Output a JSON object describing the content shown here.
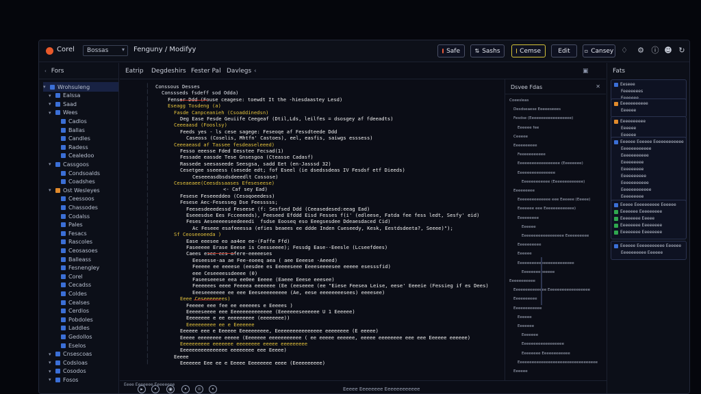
{
  "titlebar": {
    "app_name": "Corel",
    "select_value": "Bossas",
    "breadcrumb": "Fenguny / Modifyy",
    "buttons": [
      {
        "label": "Safe",
        "color": "#e85c3a"
      },
      {
        "label": "Sashs",
        "color": "#d0d4de"
      },
      {
        "label": "Cemse",
        "color": "#e5c33c"
      },
      {
        "label": "Edit",
        "color": "#c8ccd6"
      },
      {
        "label": "Cansey",
        "color": "#c8ccd6"
      }
    ]
  },
  "sidebar": {
    "header": "Fors",
    "items": [
      {
        "label": "Wrohsuleng",
        "level": 0,
        "color": "#3b6fd6"
      },
      {
        "label": "Ealssa",
        "level": 1,
        "color": "#3b6fd6"
      },
      {
        "label": "Saad",
        "level": 1,
        "color": "#3b6fd6"
      },
      {
        "label": "Wees",
        "level": 1,
        "color": "#3b6fd6"
      },
      {
        "label": "Cadlos",
        "level": 2,
        "color": "#3b6fd6"
      },
      {
        "label": "Ballas",
        "level": 2,
        "color": "#3b6fd6"
      },
      {
        "label": "Candles",
        "level": 2,
        "color": "#3b6fd6"
      },
      {
        "label": "Radess",
        "level": 2,
        "color": "#3b6fd6"
      },
      {
        "label": "Cealedoo",
        "level": 2,
        "color": "#3b6fd6"
      },
      {
        "label": "Cassgoos",
        "level": 1,
        "color": "#3b6fd6"
      },
      {
        "label": "Condsoalds",
        "level": 2,
        "color": "#3b6fd6"
      },
      {
        "label": "Coadshes",
        "level": 2,
        "color": "#3b6fd6"
      },
      {
        "label": "Ost Wesleyes",
        "level": 1,
        "color": "#e08a2c"
      },
      {
        "label": "Ceessoos",
        "level": 2,
        "color": "#3b6fd6"
      },
      {
        "label": "Chassodes",
        "level": 2,
        "color": "#3b6fd6"
      },
      {
        "label": "Codalss",
        "level": 2,
        "color": "#3b6fd6"
      },
      {
        "label": "Pales",
        "level": 2,
        "color": "#3b6fd6"
      },
      {
        "label": "Fesacs",
        "level": 2,
        "color": "#3b6fd6"
      },
      {
        "label": "Rascoles",
        "level": 2,
        "color": "#3b6fd6"
      },
      {
        "label": "Ceosasoes",
        "level": 2,
        "color": "#3b6fd6"
      },
      {
        "label": "Balleass",
        "level": 2,
        "color": "#3b6fd6"
      },
      {
        "label": "Fesnengley",
        "level": 2,
        "color": "#3b6fd6"
      },
      {
        "label": "Corel",
        "level": 2,
        "color": "#3b6fd6"
      },
      {
        "label": "Cecadss",
        "level": 2,
        "color": "#3b6fd6"
      },
      {
        "label": "Coldes",
        "level": 2,
        "color": "#3b6fd6"
      },
      {
        "label": "Cealses",
        "level": 2,
        "color": "#3b6fd6"
      },
      {
        "label": "Cerdlos",
        "level": 2,
        "color": "#3b6fd6"
      },
      {
        "label": "Pobdoles",
        "level": 2,
        "color": "#3b6fd6"
      },
      {
        "label": "Laddles",
        "level": 2,
        "color": "#3b6fd6"
      },
      {
        "label": "Gedollos",
        "level": 2,
        "color": "#3b6fd6"
      },
      {
        "label": "Eselos",
        "level": 2,
        "color": "#3b6fd6"
      },
      {
        "label": "Cnsescoas",
        "level": 1,
        "color": "#3b6fd6"
      },
      {
        "label": "Codsloas",
        "level": 1,
        "color": "#3b6fd6"
      },
      {
        "label": "Cosodos",
        "level": 1,
        "color": "#3b6fd6"
      },
      {
        "label": "Fosos",
        "level": 1,
        "color": "#3b6fd6"
      }
    ]
  },
  "editor": {
    "tabs": [
      "Eatrip",
      "Degdeshirs",
      "Fester Pal",
      "Davlegs"
    ],
    "lines": [
      {
        "t": "Conssous Desses",
        "c": "#dfe3ea",
        "i": 0
      },
      {
        "t": "Conssseds fsdeff sod Odda)",
        "c": "#dfe3ea",
        "i": 1
      },
      {
        "t": "Fenser Ddd (Fouse ceagese: toewdt It the -hiesdaastey Lesd)",
        "c": "#f2f2f2",
        "i": 2
      },
      {
        "t": "Eseagg Tosdeng (a)",
        "c": "#e5c33c",
        "i": 2
      },
      {
        "t": "Fasde Canpceanieh (Csoaddinedsn)",
        "c": "#e5c33c",
        "i": 3
      },
      {
        "t": "Deg Ease Fesde Geuiife Ceegeaf (Dtil,Lds, leilfes = dsosgey af fdeeadts)",
        "c": "#f2f2f2",
        "i": 4
      },
      {
        "t": "Ceeeaasd (Fooslsy)",
        "c": "#e5c33c",
        "i": 3
      },
      {
        "t": "Feeds yes - ls cese sagege: Feseoqe af Fessdteede Ddd",
        "c": "#f2f2f2",
        "i": 4
      },
      {
        "t": "Caseoss (Coselis, Mhtfn' Castoes), eel, easfis, saiwgs esssess)",
        "c": "#f2f2f2",
        "i": 5
      },
      {
        "t": "Ceeeaeasd af Tassee fesdeaseleeed)",
        "c": "#e5c33c",
        "i": 3
      },
      {
        "t": "Fesso eeesse Fded Eesstee Fecsad(1)",
        "c": "#f2f2f2",
        "i": 4
      },
      {
        "t": "Fessade eassde Tese Gnsesgoa (Cteasse Cadasf)",
        "c": "#f2f2f2",
        "i": 4
      },
      {
        "t": "Rassede seesaseede Seesgsa, sadd Eet (en-Jasssd 32)",
        "c": "#f2f2f2",
        "i": 4
      },
      {
        "t": "Cesetgee sseeess (sesede edt; fof Eseel (ie dsedssdeas IV Fesdsf etf Dieeds)",
        "c": "#f2f2f2",
        "i": 4
      },
      {
        "t": "Ceseeeasdbsdsdeeedlt Cossose)",
        "c": "#f2f2f2",
        "i": 6
      },
      {
        "t": "Ceseaeaee(Ceesdssaases Efeseseese)",
        "c": "#e5c33c",
        "i": 3
      },
      {
        "t": "<- Caf sey Ead)",
        "c": "#f2f2f2",
        "i": 11
      },
      {
        "t": "Fesese Feseeeddeo (Cesoqoeedess)",
        "c": "#f2f2f2",
        "i": 4
      },
      {
        "t": "Fesese Aec-Fesesseg Dse Feesssss;",
        "c": "#f2f2f2",
        "i": 4
      },
      {
        "t": "Feesesdeeedessd Feseese (f: Sesfsed Ddd (Ceeasedesed:eeag Ead)",
        "c": "#f2f2f2",
        "i": 5
      },
      {
        "t": "Eseeesdse Ees Fcceeeeds), Feeseed Efddd Eisd Fesses f(i' (edleese, Fatda fee fess ledt, Sesfy' eid)",
        "c": "#f2f2f2",
        "i": 5
      },
      {
        "t": "Feses Aeseeeeeseedeeedi  fsdse Eooseq eso Eeegsesdee Ddeaesdaced Cid)",
        "c": "#f2f2f2",
        "i": 5
      },
      {
        "t": "Ac Feseee esafeeessa (efies beaees ee ddde Inden Cueseedy, Kesk, Eestdsdeeta?, Seeee)\");",
        "c": "#f2f2f2",
        "i": 6
      },
      {
        "t": "Sf Ceoseeoeeda )",
        "c": "#e5c33c",
        "i": 3
      },
      {
        "t": "Ease eeesee eo aa4ee ee-(Faffe Ffd)",
        "c": "#f2f2f2",
        "i": 5
      },
      {
        "t": "Faseeeee Erase Eeese is Ceesseeee); Fessdg Ease--Eeesle (Lcseefdees)",
        "c": "#f2f2f2",
        "i": 5
      },
      {
        "t": "Caees esee ees afere-eeeeeses",
        "c": "#f2f2f2",
        "i": 5
      },
      {
        "t": "Eeseesse-aa ae Fee-eoeeq aea ( aee Eeeese -Aeeed)",
        "c": "#f2f2f2",
        "i": 6
      },
      {
        "t": "Feeeee ee eeeese (eesdee es Eeeeeseee Eeeeseeeesee eeeee esesssfid)",
        "c": "#f2f2f2",
        "i": 6
      },
      {
        "t": "eee Ceseeeessdeeee (0)",
        "c": "#f2f2f2",
        "i": 6
      },
      {
        "t": "Faseeseeese eea ee0ee Eeeee (Eaeee Eeese eeesee)",
        "c": "#f2f2f2",
        "i": 6
      },
      {
        "t": "Feeeeees eeee Feeeea eeeeeee (Ee (eeseeee (ee \"Eiese Feesea Leise, eese' Eeeeie (Fessieg if es Dees)",
        "c": "#f2f2f2",
        "i": 6
      },
      {
        "t": "Eeeseeeeeee ee eee Eeeseeeeeeeee (Ae, eese eeeeeeeesees) eeeesee)",
        "c": "#f2f2f2",
        "i": 6
      },
      {
        "t": "Eeee Ceseeeeeees)",
        "c": "#e5c33c",
        "i": 4
      },
      {
        "t": "Feeeee eee fee ee eeeeees e Eeeees )",
        "c": "#f2f2f2",
        "i": 5
      },
      {
        "t": "Eeeeeseeee eee Eeeeeeeeeeeeee (Eeeeeeeseeeeee U 1 Eeeeee)",
        "c": "#f2f2f2",
        "i": 5
      },
      {
        "t": "Eeeeeeee e ee eeeeeeeee (eeeeeeee))",
        "c": "#f2f2f2",
        "i": 5
      },
      {
        "t": "Eeeeeeeeee ee e Eeeeeee",
        "c": "#e5c33c",
        "i": 5
      },
      {
        "t": "Eeeeee eee e Eeeeee Eeeeeeeeee, Eeeeeeeeeeeeeeee eeeeeeee (E eeeee)",
        "c": "#f2f2f2",
        "i": 4
      },
      {
        "t": "Eeeee eeeeeeee eeeee (Eeeeeee eeeeeeeeeee ( ee eeeee eeeeee, eeeee eeeeeeee eee eee Eeeeee eeeeee)",
        "c": "#f2f2f2",
        "i": 4
      },
      {
        "t": "Eeeeeeeeee eeeeeee eeeeeeee eeeee eeeeeeeee",
        "c": "#e5c33c",
        "i": 4
      },
      {
        "t": "Eeeeeeeeeeeeeeee eeeeeeee eee Eeeee)",
        "c": "#f2f2f2",
        "i": 4
      },
      {
        "t": "Eeeee",
        "c": "#f2f2f2",
        "i": 3
      },
      {
        "t": "Eeeeeee Eee ee e Eeeee Eeeeeeee eeee (Eeeeeeeeee)",
        "c": "#f2f2f2",
        "i": 4
      }
    ]
  },
  "outline": {
    "header": "Dsvee Fdas",
    "items": [
      {
        "t": "Coeesleas",
        "i": 0
      },
      {
        "t": "Desdseaese Eeeeeseees",
        "i": 1
      },
      {
        "t": "Fesdse (Eeeeeeeeeeeeeeeeee)",
        "i": 1
      },
      {
        "t": "Eeeeee fee",
        "i": 2
      },
      {
        "t": "Ceeeee",
        "i": 1
      },
      {
        "t": "Eeeeeeeeee",
        "i": 1
      },
      {
        "t": "Feeeeeeeeeee",
        "i": 2
      },
      {
        "t": "Eeeeeeeeeeeeeeeeee (Eeeeeeee)",
        "i": 2
      },
      {
        "t": "Eeeeeeeeeeeeeeee",
        "i": 2
      },
      {
        "t": "Eeeeeeeeeeee (Eeeeeeeeeeeee)",
        "i": 3
      },
      {
        "t": "Eeeeeeeee",
        "i": 1
      },
      {
        "t": "Eeeeeeeeeeeeee eee Eeeeee (Eeeee)",
        "i": 2
      },
      {
        "t": "Eeeeeee eee Eeeeeeeeeeeee)",
        "i": 2
      },
      {
        "t": "Eeeeeeeee",
        "i": 2
      },
      {
        "t": "Eeeeee",
        "i": 3
      },
      {
        "t": "Eeeeeeeeeeeeeeeeee Eeeeeeeeee",
        "i": 3
      },
      {
        "t": "Eeeeeeeeee",
        "i": 2
      },
      {
        "t": "Eeeeee",
        "i": 2
      },
      {
        "t": "Eeeeeeeeeeeeeeeeeeeeeeee",
        "i": 2
      },
      {
        "t": "Eeeeeeeeeeeeee",
        "i": 3
      },
      {
        "t": "Eeeeeeeeeee",
        "i": 0
      },
      {
        "t": "Eeeeeeeeeeeeee Eeeeeeeeeeeeeeeeee",
        "i": 1
      },
      {
        "t": "Eeeeeeeeee",
        "i": 1
      },
      {
        "t": "Eeeeeeeeeeee",
        "i": 1
      },
      {
        "t": "Eeeeee",
        "i": 2
      },
      {
        "t": "Eeeeeee",
        "i": 2
      },
      {
        "t": "Eeeeeee",
        "i": 3
      },
      {
        "t": "Eeeeeeeeeeeeeeeeee",
        "i": 3
      },
      {
        "t": "Eeeeeeee Eeeeeeeeeeee",
        "i": 3
      },
      {
        "t": "Eeeeeeeeeeeeeeeeeeeeeeeeeeeeeeeeee",
        "i": 2
      },
      {
        "t": "Eeeeee",
        "i": 1
      }
    ]
  },
  "right_panel": {
    "header": "Fats",
    "cards": [
      {
        "rows": [
          {
            "t": "Eeseee",
            "c": "#3b6fd6"
          },
          {
            "t": "Feeeeeees",
            "c": ""
          },
          {
            "t": "Eeeeeee",
            "c": ""
          }
        ]
      },
      {
        "rows": [
          {
            "t": "Eeeeeeeeeee",
            "c": "#e08a2c"
          },
          {
            "t": "Eeeeee",
            "c": ""
          }
        ]
      },
      {
        "rows": [
          {
            "t": "Eeeeeeeeee",
            "c": "#e08a2c"
          },
          {
            "t": "Eeeeee",
            "c": ""
          },
          {
            "t": "Eeeeee",
            "c": ""
          }
        ]
      },
      {
        "rows": [
          {
            "t": "Eeeeee Eeeeee Eeeeeeeeeeee",
            "c": "#3b6fd6"
          },
          {
            "t": "Eeeeeeeeeeee",
            "c": ""
          },
          {
            "t": "Eeeeeeeeeee",
            "c": ""
          },
          {
            "t": "Eeeeeeeee",
            "c": ""
          },
          {
            "t": "Eeeeeeeee",
            "c": ""
          },
          {
            "t": "Eeeeeeeeee",
            "c": ""
          },
          {
            "t": "Eeeeeeeeeee",
            "c": ""
          },
          {
            "t": "Eeeeeeeeeeee",
            "c": ""
          },
          {
            "t": "Eeeeeeeee",
            "c": ""
          }
        ]
      },
      {
        "rows": [
          {
            "t": "Eeeee Eeeeeeeeee Eeeeee",
            "c": "#3b6fd6"
          },
          {
            "t": "Eeeeeee Eeeeeeeee",
            "c": "#2fa84f"
          },
          {
            "t": "Eeeeeeee Eeeee",
            "c": "#2fa84f"
          },
          {
            "t": "Eeeeeeee Eeeeeeee",
            "c": "#2fa84f"
          },
          {
            "t": "Eeeeeeee Eeeeeeee",
            "c": "#2fa84f"
          }
        ]
      },
      {
        "rows": [
          {
            "t": "Eeeeee Eeeeeeeeeee Eeeeee",
            "c": "#3b6fd6"
          },
          {
            "t": "Eeeeeeeeee Eeeeee",
            "c": ""
          }
        ]
      }
    ]
  },
  "statusbar": {
    "left": "Eeee Eeeeeee Eeeeeeee",
    "center": "Eeeee Eeeeeeee Eeeeeeeeeeee",
    "icons": [
      "play-icon",
      "chat-icon",
      "camera-icon",
      "pin-icon",
      "globe-icon",
      "message-icon"
    ]
  }
}
